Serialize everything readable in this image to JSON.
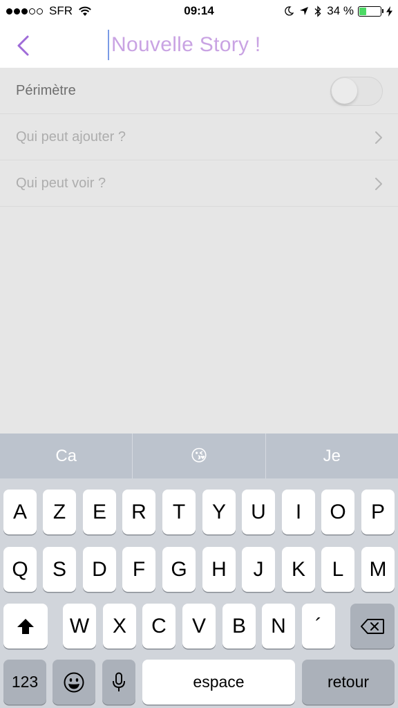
{
  "status_bar": {
    "carrier": "SFR",
    "time": "09:14",
    "battery_percent": "34 %",
    "battery_level": 0.34
  },
  "nav": {
    "title": "Nouvelle Story !"
  },
  "settings": {
    "rows": [
      {
        "label": "Périmètre",
        "control": "toggle",
        "on": false
      },
      {
        "label": "Qui peut ajouter ?",
        "control": "chevron"
      },
      {
        "label": "Qui peut voir ?",
        "control": "chevron"
      }
    ]
  },
  "keyboard": {
    "suggestions": [
      "Ca",
      "😘",
      "Je"
    ],
    "row1": [
      "A",
      "Z",
      "E",
      "R",
      "T",
      "Y",
      "U",
      "I",
      "O",
      "P"
    ],
    "row2": [
      "Q",
      "S",
      "D",
      "F",
      "G",
      "H",
      "J",
      "K",
      "L",
      "M"
    ],
    "row3": [
      "W",
      "X",
      "C",
      "V",
      "B",
      "N",
      "´"
    ],
    "numbers_label": "123",
    "space_label": "espace",
    "return_label": "retour"
  }
}
